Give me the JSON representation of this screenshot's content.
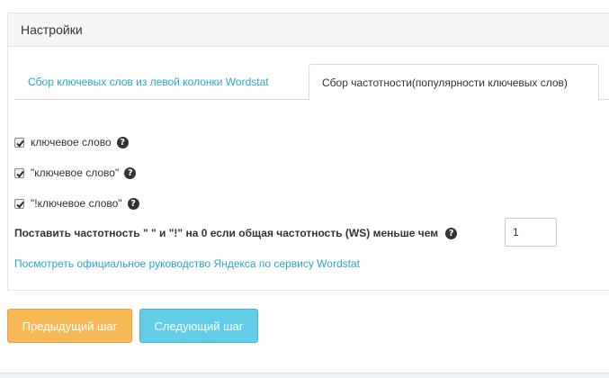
{
  "panel": {
    "title": "Настройки"
  },
  "tabs": [
    {
      "label": "Сбор ключевых слов из левой колонки Wordstat",
      "active": false
    },
    {
      "label": "Сбор частотности(популярности ключевых слов)",
      "active": true
    }
  ],
  "options": [
    {
      "label": "ключевое слово",
      "checked": true
    },
    {
      "label": "\"ключевое слово\"",
      "checked": true
    },
    {
      "label": "\"!ключевое слово\"",
      "checked": true
    }
  ],
  "threshold": {
    "label_part1": "Поставить частотность \" \" и \"!\" на ",
    "label_zero": "0",
    "label_part2": " если общая частотность (WS) меньше чем",
    "value": "1"
  },
  "guide_link": "Посмотреть официальное руководство Яндекса по сервису Wordstat",
  "buttons": {
    "prev": "Предыдущий шаг",
    "next": "Следующий шаг"
  },
  "help_glyph": "?",
  "colors": {
    "link": "#2ba5c9",
    "prev_button": "#f6b955",
    "next_button": "#62cde9"
  }
}
